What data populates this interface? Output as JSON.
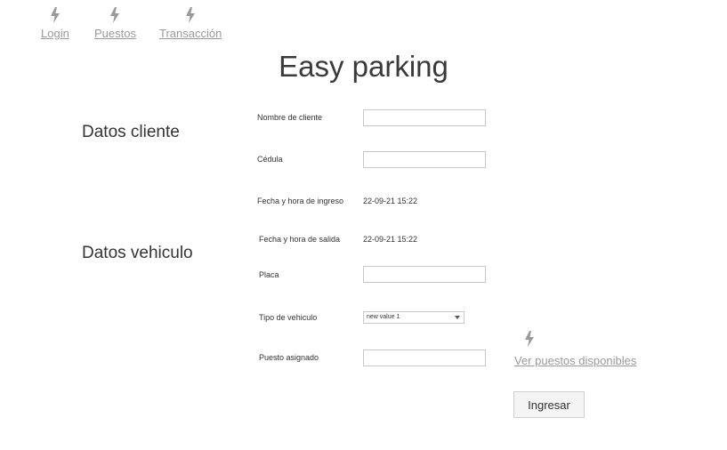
{
  "nav": {
    "items": [
      {
        "label": "Login",
        "icon": "lightning-bolt-icon"
      },
      {
        "label": "Puestos",
        "icon": "lightning-bolt-icon"
      },
      {
        "label": "Transacción",
        "icon": "lightning-bolt-icon"
      }
    ]
  },
  "page": {
    "title": "Easy parking"
  },
  "sections": {
    "cliente": "Datos cliente",
    "vehiculo": "Datos vehiculo"
  },
  "form": {
    "nombre_label": "Nombre de cliente",
    "nombre_value": "",
    "cedula_label": "Cédula",
    "cedula_value": "",
    "ingreso_label": "Fecha y hora de ingreso",
    "ingreso_value": "22-09-21 15:22",
    "salida_label": "Fecha y hora de salida",
    "salida_value": "22-09-21 15:22",
    "placa_label": "Placa",
    "placa_value": "",
    "tipo_label": "Tipo de vehiculo",
    "tipo_selected": "new value 1",
    "puesto_label": "Puesto asignado",
    "puesto_value": ""
  },
  "actions": {
    "available_link": "Ver puestos disponibles",
    "available_icon": "lightning-bolt-icon",
    "submit_label": "Ingresar"
  },
  "colors": {
    "link_gray": "#9a9a9a",
    "icon_gray": "#9a9a9a",
    "text_dark": "#333333"
  }
}
